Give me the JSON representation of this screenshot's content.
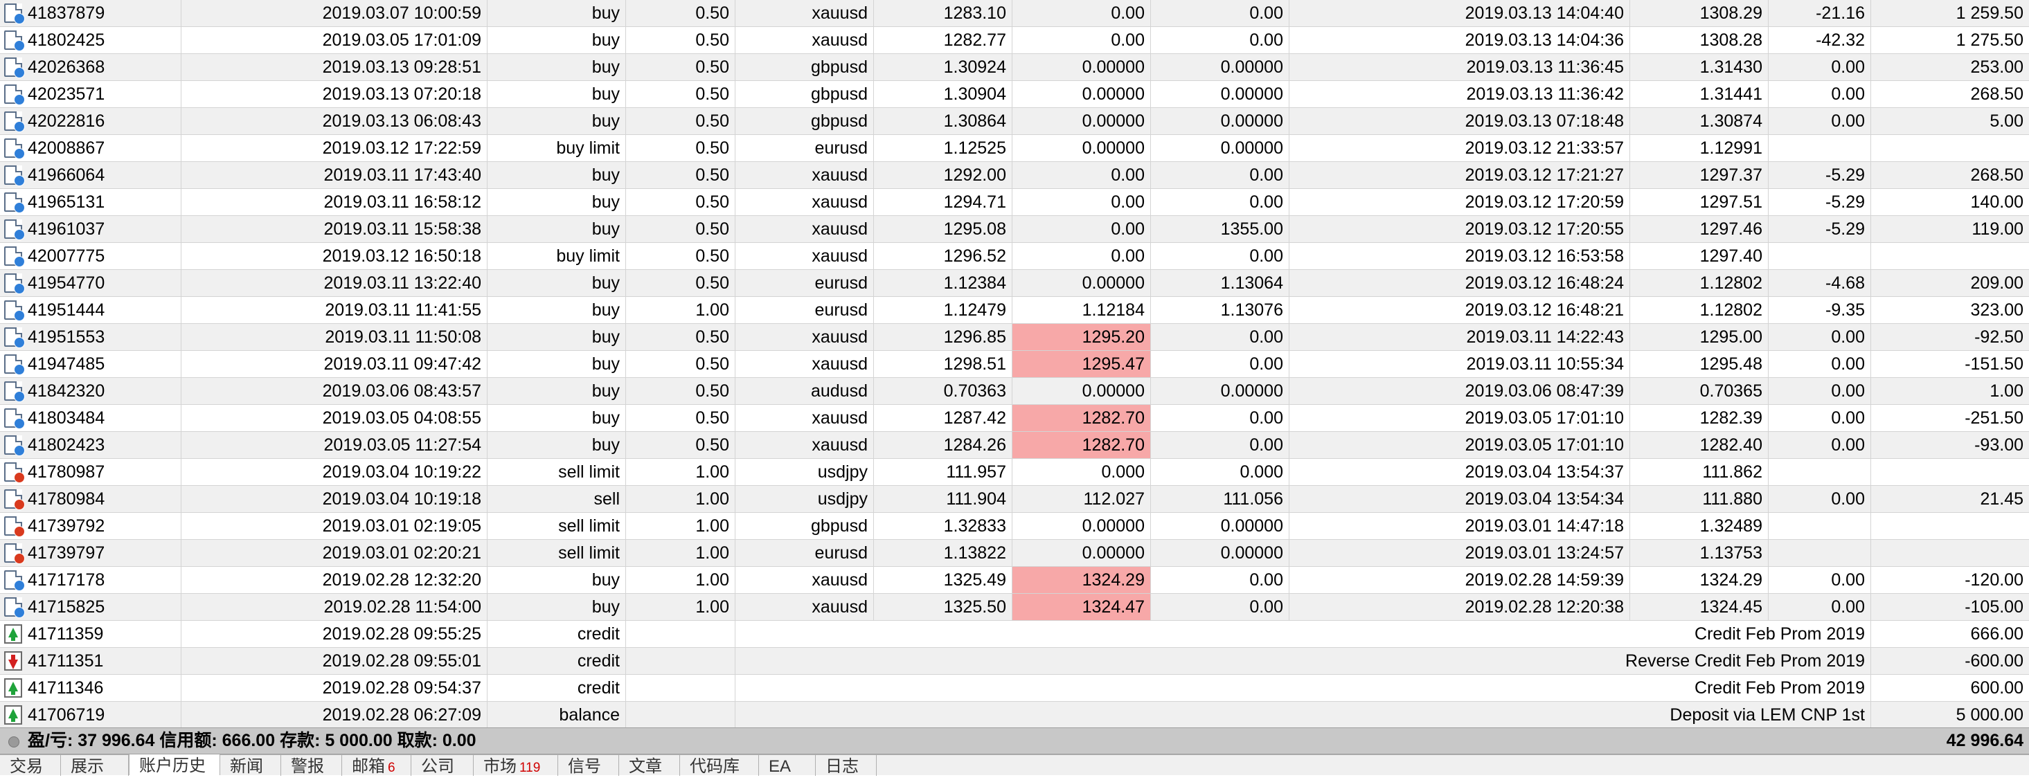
{
  "orders": [
    {
      "ticket": "41837879",
      "open_time": "2019.03.07 10:00:59",
      "type": "buy",
      "size": "0.50",
      "symbol": "xauusd",
      "price": "1283.10",
      "sl": "0.00",
      "tp": "0.00",
      "close_time": "2019.03.13 14:04:40",
      "close_price": "1308.29",
      "swap": "-21.16",
      "profit": "1 259.50",
      "icon": "order-buy-icon",
      "sl_highlight": false
    },
    {
      "ticket": "41802425",
      "open_time": "2019.03.05 17:01:09",
      "type": "buy",
      "size": "0.50",
      "symbol": "xauusd",
      "price": "1282.77",
      "sl": "0.00",
      "tp": "0.00",
      "close_time": "2019.03.13 14:04:36",
      "close_price": "1308.28",
      "swap": "-42.32",
      "profit": "1 275.50",
      "icon": "order-buy-icon",
      "sl_highlight": false
    },
    {
      "ticket": "42026368",
      "open_time": "2019.03.13 09:28:51",
      "type": "buy",
      "size": "0.50",
      "symbol": "gbpusd",
      "price": "1.30924",
      "sl": "0.00000",
      "tp": "0.00000",
      "close_time": "2019.03.13 11:36:45",
      "close_price": "1.31430",
      "swap": "0.00",
      "profit": "253.00",
      "icon": "order-buy-icon",
      "sl_highlight": false
    },
    {
      "ticket": "42023571",
      "open_time": "2019.03.13 07:20:18",
      "type": "buy",
      "size": "0.50",
      "symbol": "gbpusd",
      "price": "1.30904",
      "sl": "0.00000",
      "tp": "0.00000",
      "close_time": "2019.03.13 11:36:42",
      "close_price": "1.31441",
      "swap": "0.00",
      "profit": "268.50",
      "icon": "order-buy-icon",
      "sl_highlight": false
    },
    {
      "ticket": "42022816",
      "open_time": "2019.03.13 06:08:43",
      "type": "buy",
      "size": "0.50",
      "symbol": "gbpusd",
      "price": "1.30864",
      "sl": "0.00000",
      "tp": "0.00000",
      "close_time": "2019.03.13 07:18:48",
      "close_price": "1.30874",
      "swap": "0.00",
      "profit": "5.00",
      "icon": "order-buy-icon",
      "sl_highlight": false
    },
    {
      "ticket": "42008867",
      "open_time": "2019.03.12 17:22:59",
      "type": "buy limit",
      "size": "0.50",
      "symbol": "eurusd",
      "price": "1.12525",
      "sl": "0.00000",
      "tp": "0.00000",
      "close_time": "2019.03.12 21:33:57",
      "close_price": "1.12991",
      "swap": "",
      "profit": "",
      "icon": "order-buy-icon",
      "sl_highlight": false
    },
    {
      "ticket": "41966064",
      "open_time": "2019.03.11 17:43:40",
      "type": "buy",
      "size": "0.50",
      "symbol": "xauusd",
      "price": "1292.00",
      "sl": "0.00",
      "tp": "0.00",
      "close_time": "2019.03.12 17:21:27",
      "close_price": "1297.37",
      "swap": "-5.29",
      "profit": "268.50",
      "icon": "order-buy-icon",
      "sl_highlight": false
    },
    {
      "ticket": "41965131",
      "open_time": "2019.03.11 16:58:12",
      "type": "buy",
      "size": "0.50",
      "symbol": "xauusd",
      "price": "1294.71",
      "sl": "0.00",
      "tp": "0.00",
      "close_time": "2019.03.12 17:20:59",
      "close_price": "1297.51",
      "swap": "-5.29",
      "profit": "140.00",
      "icon": "order-buy-icon",
      "sl_highlight": false
    },
    {
      "ticket": "41961037",
      "open_time": "2019.03.11 15:58:38",
      "type": "buy",
      "size": "0.50",
      "symbol": "xauusd",
      "price": "1295.08",
      "sl": "0.00",
      "tp": "1355.00",
      "close_time": "2019.03.12 17:20:55",
      "close_price": "1297.46",
      "swap": "-5.29",
      "profit": "119.00",
      "icon": "order-buy-icon",
      "sl_highlight": false
    },
    {
      "ticket": "42007775",
      "open_time": "2019.03.12 16:50:18",
      "type": "buy limit",
      "size": "0.50",
      "symbol": "xauusd",
      "price": "1296.52",
      "sl": "0.00",
      "tp": "0.00",
      "close_time": "2019.03.12 16:53:58",
      "close_price": "1297.40",
      "swap": "",
      "profit": "",
      "icon": "order-buy-icon",
      "sl_highlight": false
    },
    {
      "ticket": "41954770",
      "open_time": "2019.03.11 13:22:40",
      "type": "buy",
      "size": "0.50",
      "symbol": "eurusd",
      "price": "1.12384",
      "sl": "0.00000",
      "tp": "1.13064",
      "close_time": "2019.03.12 16:48:24",
      "close_price": "1.12802",
      "swap": "-4.68",
      "profit": "209.00",
      "icon": "order-buy-icon",
      "sl_highlight": false
    },
    {
      "ticket": "41951444",
      "open_time": "2019.03.11 11:41:55",
      "type": "buy",
      "size": "1.00",
      "symbol": "eurusd",
      "price": "1.12479",
      "sl": "1.12184",
      "tp": "1.13076",
      "close_time": "2019.03.12 16:48:21",
      "close_price": "1.12802",
      "swap": "-9.35",
      "profit": "323.00",
      "icon": "order-buy-icon",
      "sl_highlight": false
    },
    {
      "ticket": "41951553",
      "open_time": "2019.03.11 11:50:08",
      "type": "buy",
      "size": "0.50",
      "symbol": "xauusd",
      "price": "1296.85",
      "sl": "1295.20",
      "tp": "0.00",
      "close_time": "2019.03.11 14:22:43",
      "close_price": "1295.00",
      "swap": "0.00",
      "profit": "-92.50",
      "icon": "order-buy-icon",
      "sl_highlight": true
    },
    {
      "ticket": "41947485",
      "open_time": "2019.03.11 09:47:42",
      "type": "buy",
      "size": "0.50",
      "symbol": "xauusd",
      "price": "1298.51",
      "sl": "1295.47",
      "tp": "0.00",
      "close_time": "2019.03.11 10:55:34",
      "close_price": "1295.48",
      "swap": "0.00",
      "profit": "-151.50",
      "icon": "order-buy-icon",
      "sl_highlight": true
    },
    {
      "ticket": "41842320",
      "open_time": "2019.03.06 08:43:57",
      "type": "buy",
      "size": "0.50",
      "symbol": "audusd",
      "price": "0.70363",
      "sl": "0.00000",
      "tp": "0.00000",
      "close_time": "2019.03.06 08:47:39",
      "close_price": "0.70365",
      "swap": "0.00",
      "profit": "1.00",
      "icon": "order-buy-icon",
      "sl_highlight": false
    },
    {
      "ticket": "41803484",
      "open_time": "2019.03.05 04:08:55",
      "type": "buy",
      "size": "0.50",
      "symbol": "xauusd",
      "price": "1287.42",
      "sl": "1282.70",
      "tp": "0.00",
      "close_time": "2019.03.05 17:01:10",
      "close_price": "1282.39",
      "swap": "0.00",
      "profit": "-251.50",
      "icon": "order-buy-icon",
      "sl_highlight": true
    },
    {
      "ticket": "41802423",
      "open_time": "2019.03.05 11:27:54",
      "type": "buy",
      "size": "0.50",
      "symbol": "xauusd",
      "price": "1284.26",
      "sl": "1282.70",
      "tp": "0.00",
      "close_time": "2019.03.05 17:01:10",
      "close_price": "1282.40",
      "swap": "0.00",
      "profit": "-93.00",
      "icon": "order-buy-icon",
      "sl_highlight": true
    },
    {
      "ticket": "41780987",
      "open_time": "2019.03.04 10:19:22",
      "type": "sell limit",
      "size": "1.00",
      "symbol": "usdjpy",
      "price": "111.957",
      "sl": "0.000",
      "tp": "0.000",
      "close_time": "2019.03.04 13:54:37",
      "close_price": "111.862",
      "swap": "",
      "profit": "",
      "icon": "order-sell-icon",
      "sl_highlight": false
    },
    {
      "ticket": "41780984",
      "open_time": "2019.03.04 10:19:18",
      "type": "sell",
      "size": "1.00",
      "symbol": "usdjpy",
      "price": "111.904",
      "sl": "112.027",
      "tp": "111.056",
      "close_time": "2019.03.04 13:54:34",
      "close_price": "111.880",
      "swap": "0.00",
      "profit": "21.45",
      "icon": "order-sell-icon",
      "sl_highlight": false
    },
    {
      "ticket": "41739792",
      "open_time": "2019.03.01 02:19:05",
      "type": "sell limit",
      "size": "1.00",
      "symbol": "gbpusd",
      "price": "1.32833",
      "sl": "0.00000",
      "tp": "0.00000",
      "close_time": "2019.03.01 14:47:18",
      "close_price": "1.32489",
      "swap": "",
      "profit": "",
      "icon": "order-sell-icon",
      "sl_highlight": false
    },
    {
      "ticket": "41739797",
      "open_time": "2019.03.01 02:20:21",
      "type": "sell limit",
      "size": "1.00",
      "symbol": "eurusd",
      "price": "1.13822",
      "sl": "0.00000",
      "tp": "0.00000",
      "close_time": "2019.03.01 13:24:57",
      "close_price": "1.13753",
      "swap": "",
      "profit": "",
      "icon": "order-sell-icon",
      "sl_highlight": false
    },
    {
      "ticket": "41717178",
      "open_time": "2019.02.28 12:32:20",
      "type": "buy",
      "size": "1.00",
      "symbol": "xauusd",
      "price": "1325.49",
      "sl": "1324.29",
      "tp": "0.00",
      "close_time": "2019.02.28 14:59:39",
      "close_price": "1324.29",
      "swap": "0.00",
      "profit": "-120.00",
      "icon": "order-buy-icon",
      "sl_highlight": true
    },
    {
      "ticket": "41715825",
      "open_time": "2019.02.28 11:54:00",
      "type": "buy",
      "size": "1.00",
      "symbol": "xauusd",
      "price": "1325.50",
      "sl": "1324.47",
      "tp": "0.00",
      "close_time": "2019.02.28 12:20:38",
      "close_price": "1324.45",
      "swap": "0.00",
      "profit": "-105.00",
      "icon": "order-buy-icon",
      "sl_highlight": true
    }
  ],
  "transactions": [
    {
      "ticket": "41711359",
      "time": "2019.02.28 09:55:25",
      "type": "credit",
      "comment": "Credit Feb Prom 2019",
      "amount": "666.00",
      "icon": "credit-in-icon"
    },
    {
      "ticket": "41711351",
      "time": "2019.02.28 09:55:01",
      "type": "credit",
      "comment": "Reverse Credit Feb Prom 2019",
      "amount": "-600.00",
      "icon": "credit-out-icon"
    },
    {
      "ticket": "41711346",
      "time": "2019.02.28 09:54:37",
      "type": "credit",
      "comment": "Credit Feb Prom 2019",
      "amount": "600.00",
      "icon": "credit-in-icon"
    },
    {
      "ticket": "41706719",
      "time": "2019.02.28 06:27:09",
      "type": "balance",
      "comment": "Deposit via LEM CNP 1st",
      "amount": "5 000.00",
      "icon": "deposit-icon"
    }
  ],
  "summary": {
    "text": "盈/亏: 37 996.64  信用额: 666.00  存款: 5 000.00  取款: 0.00",
    "total": "42 996.64"
  },
  "tabs": [
    {
      "label": "交易",
      "badge": ""
    },
    {
      "label": "展示",
      "badge": ""
    },
    {
      "label": "账户历史",
      "badge": "",
      "active": true
    },
    {
      "label": "新闻",
      "badge": ""
    },
    {
      "label": "警报",
      "badge": ""
    },
    {
      "label": "邮箱",
      "badge": "6"
    },
    {
      "label": "公司",
      "badge": ""
    },
    {
      "label": "市场",
      "badge": "119"
    },
    {
      "label": "信号",
      "badge": ""
    },
    {
      "label": "文章",
      "badge": ""
    },
    {
      "label": "代码库",
      "badge": ""
    },
    {
      "label": "EA",
      "badge": ""
    },
    {
      "label": "日志",
      "badge": ""
    }
  ],
  "colors": {
    "stop_loss_highlight": "#f7a8a8",
    "summary_bar": "#c8c8c8",
    "row_alt": "#f0f0f0",
    "buy_dot": "#2f7fd9",
    "sell_dot": "#d93a1e",
    "credit_in": "#1fa33a",
    "credit_out": "#d32020"
  }
}
